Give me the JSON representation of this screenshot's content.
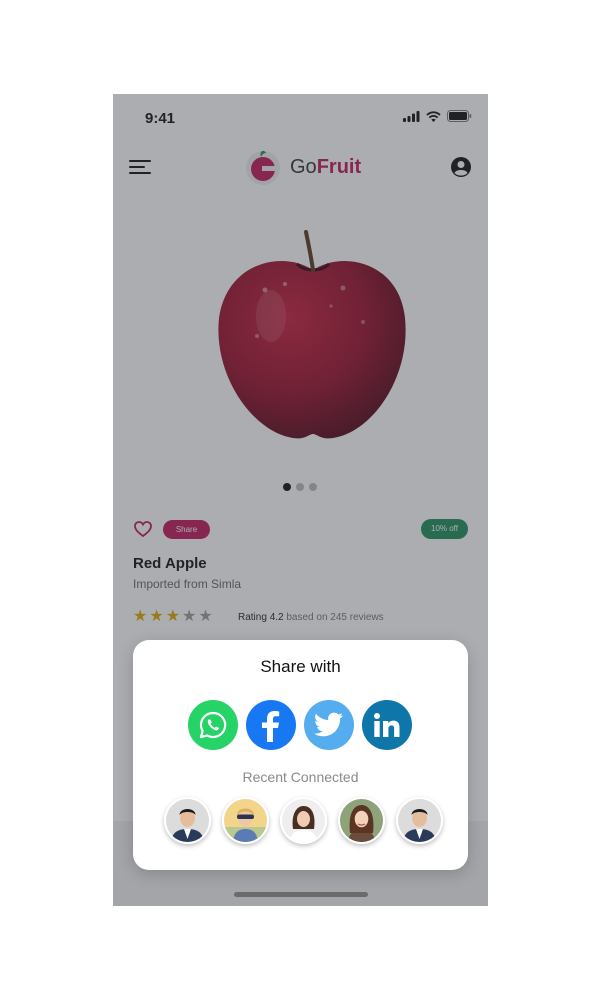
{
  "status_bar": {
    "time": "9:41"
  },
  "header": {
    "brand_prefix": "Go",
    "brand_accent": "Fruit"
  },
  "carousel": {
    "total": 3,
    "active_index": 0
  },
  "product": {
    "share_label": "Share",
    "discount": "10% off",
    "name": "Red Apple",
    "origin": "Imported from Simla",
    "rating_stars": 3,
    "rating_max": 5,
    "rating_label": "Rating",
    "rating_value": "4.2",
    "reviews_text": "based on 245 reviews"
  },
  "share_sheet": {
    "title": "Share with",
    "apps": [
      {
        "name": "WhatsApp",
        "icon": "whatsapp-icon",
        "color": "#25d366"
      },
      {
        "name": "Facebook",
        "icon": "facebook-icon",
        "color": "#1877f2"
      },
      {
        "name": "Twitter",
        "icon": "twitter-icon",
        "color": "#55acee"
      },
      {
        "name": "LinkedIn",
        "icon": "linkedin-icon",
        "color": "#0e76a8"
      }
    ],
    "recent_title": "Recent Connected",
    "recent_contacts": 5
  },
  "colors": {
    "accent": "#c2185b",
    "discount": "#1e8e5a",
    "star": "#e0a800"
  }
}
